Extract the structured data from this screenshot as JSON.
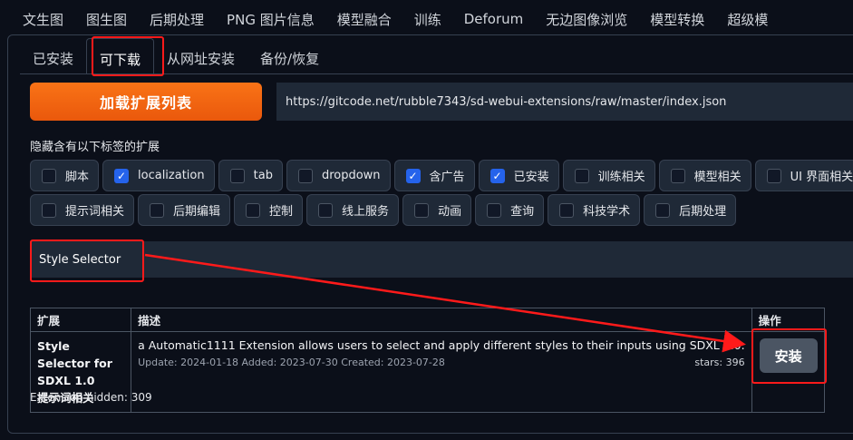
{
  "top_tabs": [
    "文生图",
    "图生图",
    "后期处理",
    "PNG 图片信息",
    "模型融合",
    "训练",
    "Deforum",
    "无边图像浏览",
    "模型转换",
    "超级模"
  ],
  "sub_tabs": [
    "已安装",
    "可下载",
    "从网址安装",
    "备份/恢复"
  ],
  "load_button": "加载扩展列表",
  "index_url": "https://gitcode.net/rubble7343/sd-webui-extensions/raw/master/index.json",
  "hide_label": "隐藏含有以下标签的扩展",
  "tags_row1": [
    {
      "label": "脚本",
      "checked": false
    },
    {
      "label": "localization",
      "checked": true
    },
    {
      "label": "tab",
      "checked": false
    },
    {
      "label": "dropdown",
      "checked": false
    },
    {
      "label": "含广告",
      "checked": true
    },
    {
      "label": "已安装",
      "checked": true
    },
    {
      "label": "训练相关",
      "checked": false
    },
    {
      "label": "模型相关",
      "checked": false
    },
    {
      "label": "UI 界面相关",
      "checked": false
    }
  ],
  "tags_row2": [
    {
      "label": "提示词相关",
      "checked": false
    },
    {
      "label": "后期编辑",
      "checked": false
    },
    {
      "label": "控制",
      "checked": false
    },
    {
      "label": "线上服务",
      "checked": false
    },
    {
      "label": "动画",
      "checked": false
    },
    {
      "label": "查询",
      "checked": false
    },
    {
      "label": "科技学术",
      "checked": false
    },
    {
      "label": "后期处理",
      "checked": false
    }
  ],
  "search_value": "Style Selector",
  "table": {
    "headers": {
      "ext": "扩展",
      "desc": "描述",
      "action": "操作"
    },
    "row": {
      "name": "Style Selector for SDXL 1.0",
      "tag": "提示词相关",
      "description": "a Automatic1111 Extension allows users to select and apply different styles to their inputs using SDXL 1.0.",
      "dates": "Update: 2024-01-18 Added: 2023-07-30 Created: 2023-07-28",
      "stars": "stars: 396",
      "install": "安装"
    }
  },
  "hidden_count": "Extension hidden: 309",
  "colors": {
    "accent": "#f97316",
    "annotation": "#ff1a1a",
    "checkbox": "#2563eb"
  }
}
